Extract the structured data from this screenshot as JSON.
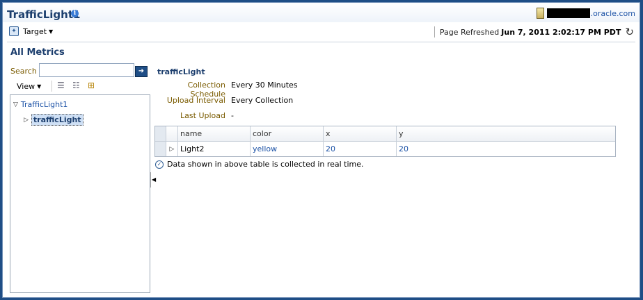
{
  "header": {
    "title": "TrafficLight1",
    "info_icon": "info-icon",
    "host_domain": ".oracle.com"
  },
  "toolbar": {
    "target_label": "Target",
    "refresh_label": "Page Refreshed",
    "refresh_time": "Jun 7, 2011 2:02:17 PM PDT"
  },
  "section": {
    "title": "All Metrics"
  },
  "search": {
    "label": "Search",
    "value": "",
    "go_icon": "arrow-right-icon"
  },
  "tree_toolbar": {
    "view_label": "View"
  },
  "tree": {
    "root": "TrafficLight1",
    "child": "trafficLight"
  },
  "detail": {
    "title": "trafficLight",
    "rows": [
      {
        "label": "Collection Schedule",
        "value": "Every 30 Minutes"
      },
      {
        "label": "Upload Interval",
        "value": "Every Collection"
      },
      {
        "label": "Last Upload",
        "value": "-"
      }
    ]
  },
  "table": {
    "headers": [
      "name",
      "color",
      "x",
      "y"
    ],
    "rows": [
      {
        "name": "Light2",
        "color": "yellow",
        "x": "20",
        "y": "20"
      }
    ]
  },
  "note": "Data shown in above table is collected in real time.",
  "colors": {
    "frame": "#1f4e86",
    "title": "#1d3f6e",
    "link": "#1c52a6",
    "label": "#7a5b00"
  }
}
